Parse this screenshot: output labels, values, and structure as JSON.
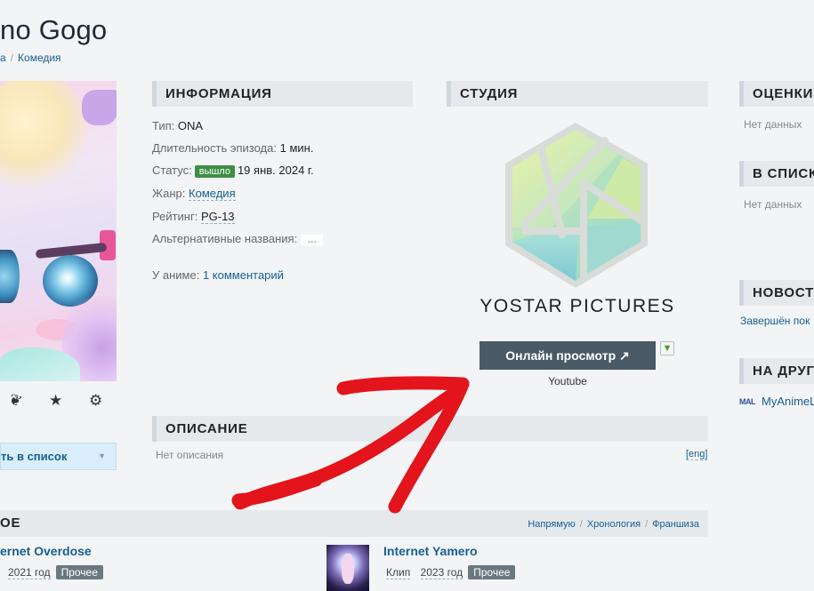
{
  "page": {
    "title": "no Gogo",
    "breadcrumbs": [
      "a",
      "Комедия"
    ]
  },
  "poster": {
    "icons": [
      "feather-icon",
      "star-icon",
      "gears-icon"
    ]
  },
  "list_button": {
    "label": "ть в список",
    "icon": "chevron-down-icon"
  },
  "info": {
    "header": "ИНФОРМАЦИЯ",
    "type_label": "Тип:",
    "type_value": "ONA",
    "duration_label": "Длительность эпизода:",
    "duration_value": "1 мин.",
    "status_label": "Статус:",
    "status_badge": "вышло",
    "status_date": "19 янв. 2024 г.",
    "genre_label": "Жанр:",
    "genre_value": "Комедия",
    "rating_label": "Рейтинг:",
    "rating_value": "PG-13",
    "alt_label": "Альтернативные названия:",
    "alt_value": "…",
    "comments_label": "У аниме:",
    "comments_value": "1 комментарий"
  },
  "studio": {
    "header": "СТУДИЯ",
    "name": "YOSTAR PICTURES",
    "online_button": "Онлайн просмотр",
    "online_source": "Youtube"
  },
  "description": {
    "header": "ОПИСАНИЕ",
    "empty": "Нет описания",
    "eng_link": "[eng]"
  },
  "right": {
    "ratings_header": "ОЦЕНКИ",
    "ratings_empty": "Нет данных",
    "lists_header": "В СПИСКА",
    "lists_empty": "Нет данных",
    "news_header": "НОВОСТИ",
    "news_link": "Завершён пок",
    "other_header": "НА ДРУГ",
    "mal_icon": "MAL",
    "mal_link": "MyAnimeL"
  },
  "related": {
    "header": "ОЕ",
    "nav": [
      "Напрямую",
      "Хронология",
      "Франшиза"
    ],
    "items": [
      {
        "title": "ernet Overdose",
        "kind": "",
        "year": "2021 год",
        "badge": "Прочее"
      },
      {
        "title": "Internet Yamero",
        "kind": "Клип",
        "year": "2023 год",
        "badge": "Прочее"
      }
    ]
  },
  "colors": {
    "link": "#176093",
    "status_green": "#3d8e45",
    "annotation_red": "#e3141b",
    "button_dark": "#495a66"
  }
}
